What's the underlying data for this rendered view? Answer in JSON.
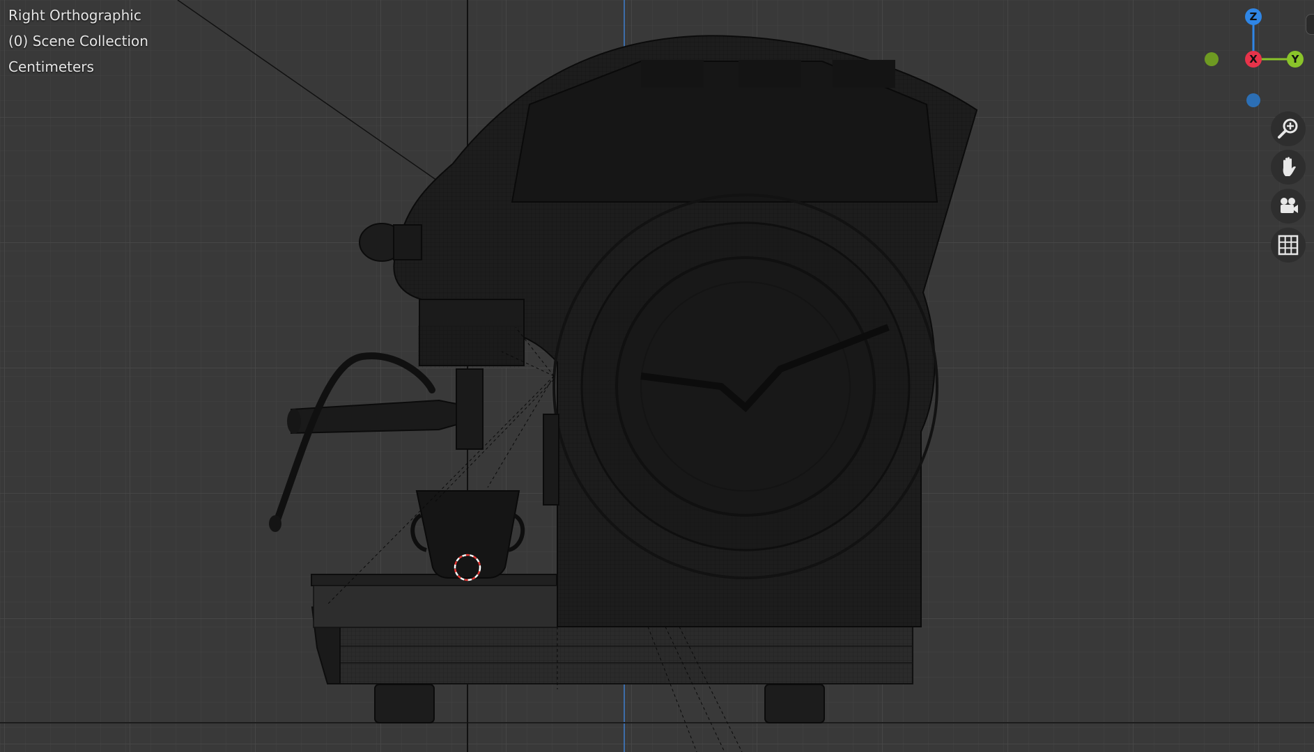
{
  "viewport": {
    "view_name": "Right Orthographic",
    "collection": "(0) Scene Collection",
    "units": "Centimeters"
  },
  "gizmo": {
    "z_label": "Z",
    "x_label": "X",
    "y_label": "Y",
    "z_color": "#2f86e6",
    "x_color": "#e8334a",
    "y_color": "#8ac42a"
  },
  "nav_buttons": [
    "zoom-icon",
    "hand-pan-icon",
    "camera-icon",
    "grid-icon"
  ],
  "colors": {
    "background": "#393939",
    "grid_minor": "#424242",
    "grid_major": "#4a4a4a",
    "model_fill": "#1c1c1c",
    "wire": "#0e0e0e"
  }
}
